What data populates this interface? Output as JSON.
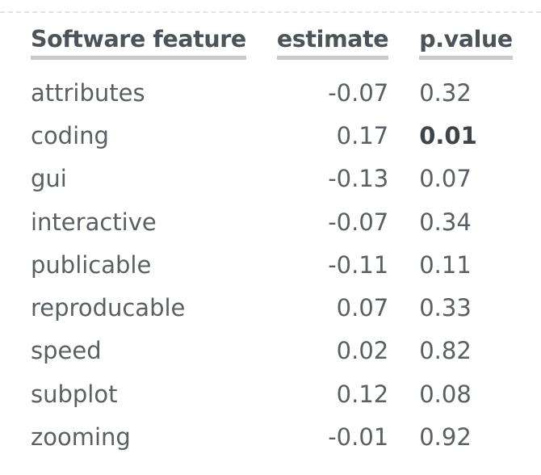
{
  "table": {
    "headers": {
      "feature": "Software feature",
      "estimate": "estimate",
      "pvalue": "p.value"
    },
    "rows": [
      {
        "feature": "attributes",
        "estimate": "-0.07",
        "pvalue": "0.32",
        "significant": false
      },
      {
        "feature": "coding",
        "estimate": "0.17",
        "pvalue": "0.01",
        "significant": true
      },
      {
        "feature": "gui",
        "estimate": "-0.13",
        "pvalue": "0.07",
        "significant": false
      },
      {
        "feature": "interactive",
        "estimate": "-0.07",
        "pvalue": "0.34",
        "significant": false
      },
      {
        "feature": "publicable",
        "estimate": "-0.11",
        "pvalue": "0.11",
        "significant": false
      },
      {
        "feature": "reproducable",
        "estimate": "0.07",
        "pvalue": "0.33",
        "significant": false
      },
      {
        "feature": "speed",
        "estimate": "0.02",
        "pvalue": "0.82",
        "significant": false
      },
      {
        "feature": "subplot",
        "estimate": "0.12",
        "pvalue": "0.08",
        "significant": false
      },
      {
        "feature": "zooming",
        "estimate": "-0.01",
        "pvalue": "0.92",
        "significant": false
      }
    ]
  }
}
